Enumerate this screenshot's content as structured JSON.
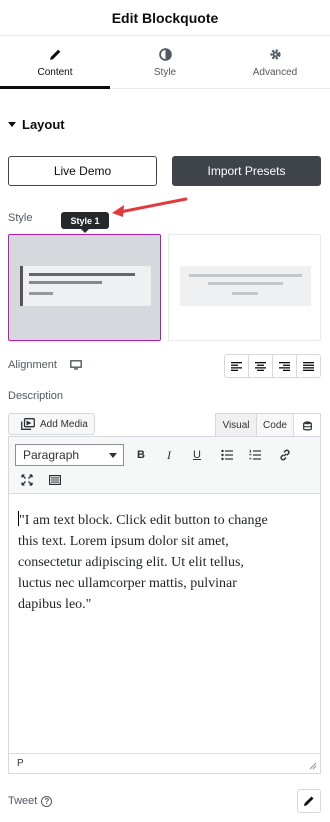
{
  "header": {
    "title": "Edit Blockquote"
  },
  "tabs": [
    {
      "label": "Content",
      "icon": "pencil-icon",
      "active": true
    },
    {
      "label": "Style",
      "icon": "half-circle-icon",
      "active": false
    },
    {
      "label": "Advanced",
      "icon": "gear-icon",
      "active": false
    }
  ],
  "section": {
    "title": "Layout"
  },
  "buttons": {
    "live_demo": "Live Demo",
    "import_presets": "Import Presets"
  },
  "style": {
    "label": "Style",
    "tooltip": "Style 1",
    "selected_index": 0,
    "accent": "#b41ab4"
  },
  "alignment": {
    "label": "Alignment",
    "device_icon": "desktop-icon"
  },
  "description": {
    "label": "Description"
  },
  "editor": {
    "add_media": "Add Media",
    "tab_visual": "Visual",
    "tab_code": "Code",
    "format": "Paragraph",
    "toolbar_bold": "B",
    "toolbar_italic": "I",
    "toolbar_underline": "U",
    "content_lines": [
      "\"I am text block. Click edit button to change",
      "this text. Lorem ipsum dolor sit amet,",
      "consectetur adipiscing elit. Ut elit tellus,",
      "luctus nec ullamcorper mattis, pulvinar",
      "dapibus leo.\""
    ],
    "status_path": "P"
  },
  "tweet": {
    "label": "Tweet"
  },
  "colors": {
    "dark_button": "#3f444b",
    "arrow": "#e03a3a"
  }
}
